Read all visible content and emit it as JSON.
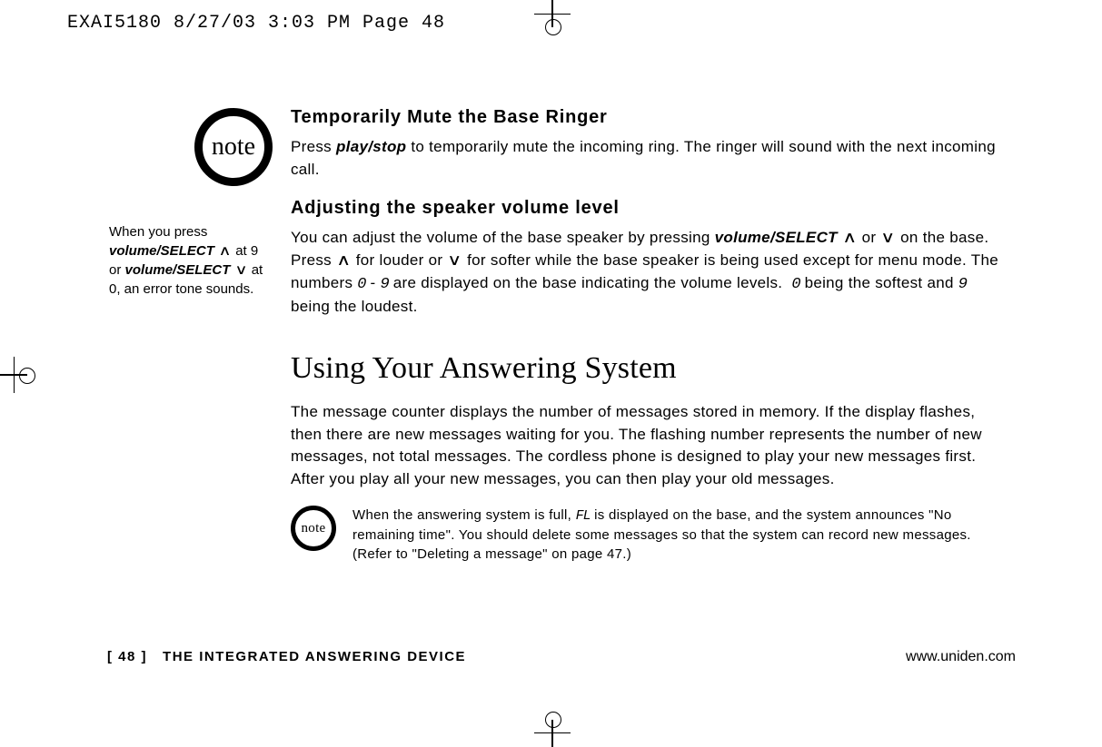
{
  "print_header": "EXAI5180  8/27/03 3:03 PM  Page 48",
  "note_label": "note",
  "sidebar": {
    "line1a": "When you press",
    "vs": "volume/SELECT",
    "up": "∧",
    "down": "∨",
    "line1b": "at 9",
    "line2a": "or",
    "line2b": "at",
    "line3": "0, an error tone sounds."
  },
  "sections": {
    "mute": {
      "heading": "Temporarily Mute the Base Ringer",
      "p1a": "Press",
      "playstop": "play/stop",
      "p1b": "to temporarily mute the incoming ring. The ringer will sound with the next incoming call."
    },
    "volume": {
      "heading": "Adjusting the speaker volume level",
      "p1a": "You can adjust the volume of the base speaker by pressing",
      "vs": "volume/SELECT",
      "up": "∧",
      "or": "or",
      "down": "∨",
      "p1b": "on the base. Press",
      "p1c": "for louder or",
      "p1d": "for softer while the base speaker is being used except for menu mode. The numbers",
      "d0": "0",
      "dash": "-",
      "d9": "9",
      "p1e": "are displayed on the base indicating the volume levels.",
      "p1f": "being the softest and",
      "p1g": "being the loudest."
    },
    "answering": {
      "title": "Using Your Answering System",
      "body": "The message counter displays the number of messages stored in memory. If the display flashes, then there are new messages waiting for you. The flashing number represents the number of new messages, not total messages. The cordless phone is designed to play your new messages first. After you play all your new messages, you can then play your old messages.",
      "note_a": "When the answering system is full,",
      "fl": "FL",
      "note_b": "is displayed on the base, and the system announces \"No remaining time\". You should delete some messages so that the system can record new messages. (Refer to \"Deleting a message\" on page 47.)"
    }
  },
  "footer": {
    "page": "[ 48 ]",
    "section": "THE INTEGRATED ANSWERING DEVICE",
    "url": "www.uniden.com"
  }
}
